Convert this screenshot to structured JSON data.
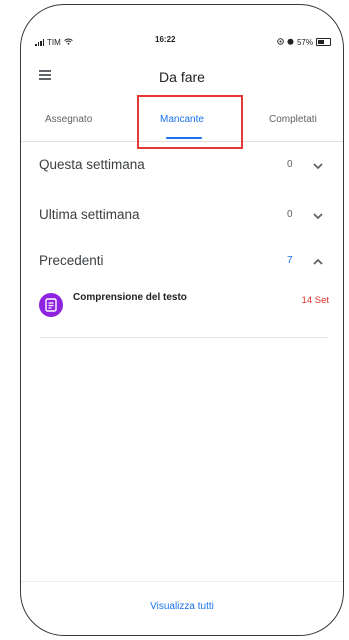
{
  "status_bar": {
    "carrier": "TIM",
    "time": "16:22",
    "battery": "57%"
  },
  "app_bar": {
    "title": "Da fare",
    "menu_icon": "menu-icon"
  },
  "tabs": [
    {
      "label": "Assegnato",
      "selected": false
    },
    {
      "label": "Mancante",
      "selected": true
    },
    {
      "label": "Completati",
      "selected": false
    }
  ],
  "sections": [
    {
      "label": "Questa settimana",
      "count": "0",
      "expanded": false
    },
    {
      "label": "Ultima settimana",
      "count": "0",
      "expanded": false
    },
    {
      "label": "Precedenti",
      "count": "7",
      "expanded": true
    }
  ],
  "items": [
    {
      "title": "Comprensione del testo",
      "date": "14 Set",
      "icon": "assignment-icon"
    }
  ],
  "footer": {
    "link": "Visualizza tutti"
  },
  "colors": {
    "accent": "#1a73e8",
    "highlight": "#e53935",
    "due": "#d93025",
    "avatar": "#8e24e0"
  }
}
